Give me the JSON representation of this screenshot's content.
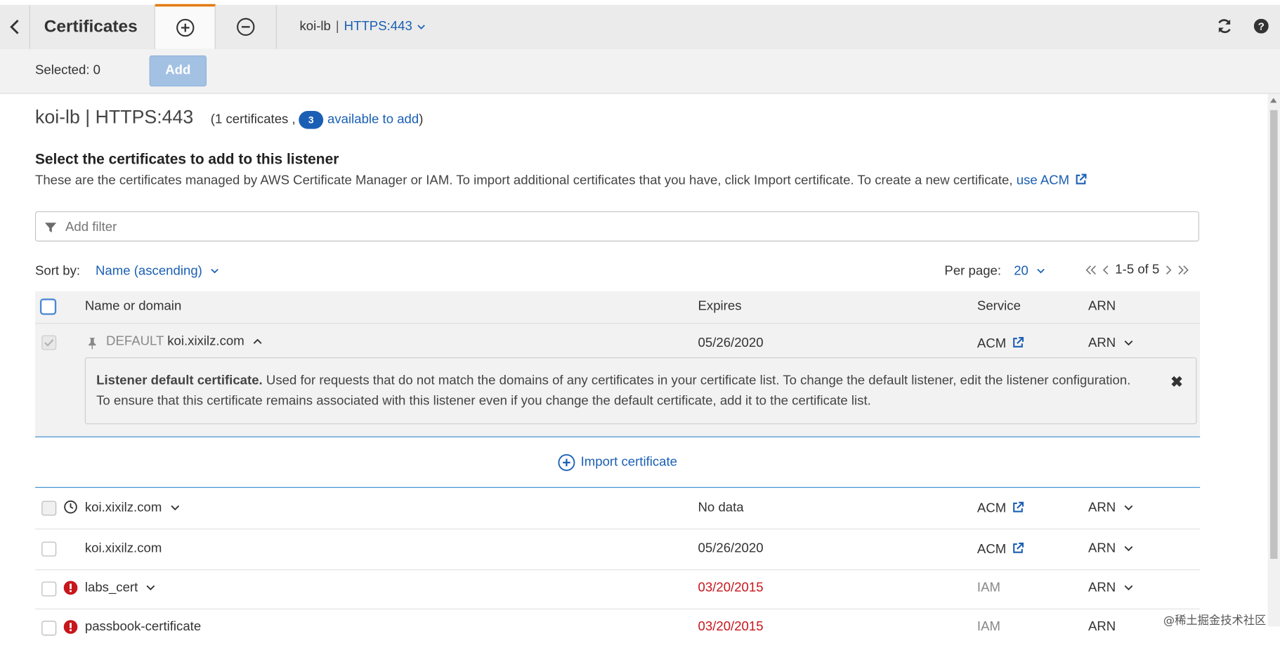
{
  "app": {
    "title": "Certificates",
    "listener_name": "koi-lb",
    "listener_protocol": "HTTPS:443",
    "separator": "|"
  },
  "toolbar": {
    "selected_label": "Selected: 0",
    "add_label": "Add"
  },
  "header": {
    "title": "koi-lb | HTTPS:443",
    "meta_prefix": "(1 certificates ,",
    "available_count": "3",
    "available_label": "available to add",
    "meta_suffix": ")"
  },
  "section": {
    "title": "Select the certificates to add to this listener",
    "description": "These are the certificates managed by AWS Certificate Manager or IAM. To import additional certificates that you have, click Import certificate. To create a new certificate,",
    "use_acm_label": "use ACM"
  },
  "filter": {
    "placeholder": "Add filter"
  },
  "sort": {
    "label": "Sort by:",
    "value": "Name (ascending)"
  },
  "pagination": {
    "per_page_label": "Per page:",
    "per_page_value": "20",
    "range": "1-5 of 5"
  },
  "table": {
    "columns": {
      "name": "Name or domain",
      "expires": "Expires",
      "service": "Service",
      "arn": "ARN"
    },
    "default_row": {
      "prefix": "DEFAULT",
      "name": "koi.xixilz.com",
      "expires": "05/26/2020",
      "service": "ACM",
      "arn": "ARN",
      "info_title": "Listener default certificate.",
      "info_text": "Used for requests that do not match the domains of any certificates in your certificate list. To change the default listener, edit the listener configuration. To ensure that this certificate remains associated with this listener even if you change the default certificate, add it to the certificate list."
    },
    "import_label": "Import certificate",
    "rows": [
      {
        "name": "koi.xixilz.com",
        "expires": "No data",
        "service": "ACM",
        "arn": "ARN"
      },
      {
        "name": "koi.xixilz.com",
        "expires": "05/26/2020",
        "service": "ACM",
        "arn": "ARN"
      },
      {
        "name": "labs_cert",
        "expires": "03/20/2015",
        "service": "IAM",
        "arn": "ARN"
      },
      {
        "name": "passbook-certificate",
        "expires": "03/20/2015",
        "service": "IAM",
        "arn": "ARN"
      }
    ]
  },
  "colors": {
    "link": "#1a5fb4",
    "accent": "#e47911",
    "error": "#c7161c",
    "divider": "#3b8ccf"
  },
  "watermark": "@稀土掘金技术社区"
}
